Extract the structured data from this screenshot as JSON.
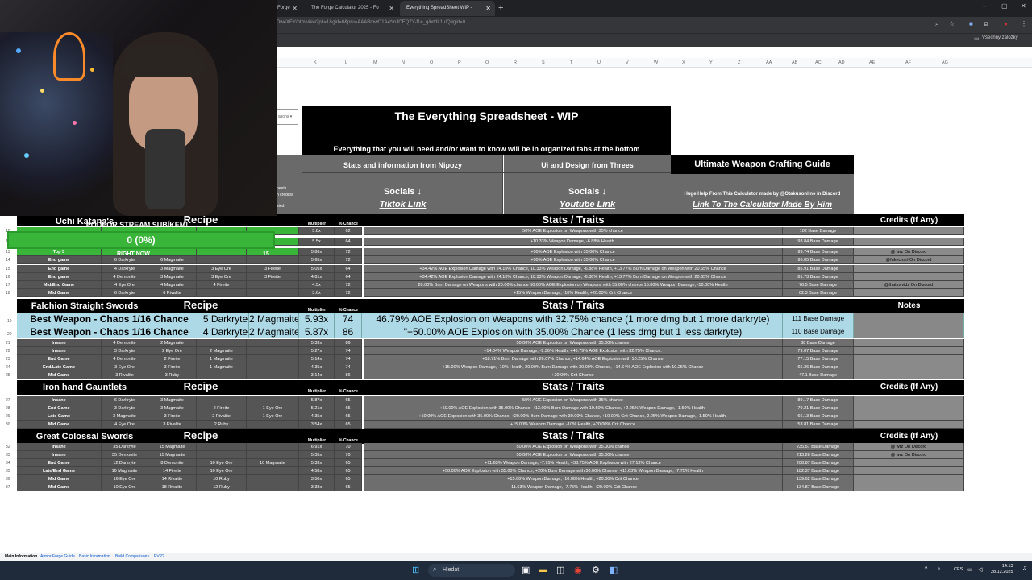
{
  "browser": {
    "tabs": [
      {
        "label": "Forge",
        "active": false
      },
      {
        "label": "The Forge Calculator 2025 - Fo",
        "active": false
      },
      {
        "label": "Everything SpreadSheet WIP -",
        "active": true
      }
    ],
    "new_tab": "+",
    "window_controls": [
      "–",
      "▢",
      "✕"
    ],
    "url": "Dw4XEY/htmlview?pli=1&gid=0&pru=AAABmwO1A4*mJCEQZY-f1e_q/ixtdL1uIQ#gid=0",
    "bookmarks_label": "Všechny záložky"
  },
  "sheet": {
    "columns": [
      "K",
      "L",
      "M",
      "N",
      "O",
      "P",
      "Q",
      "R",
      "S",
      "T",
      "U",
      "V",
      "W",
      "X",
      "Y",
      "Z",
      "AA",
      "AB",
      "AC",
      "AD",
      "AE",
      "AF",
      "AG"
    ],
    "dropdown_label": "asons",
    "side_text": [
      "heets",
      "h credits/",
      "sted"
    ],
    "title": "The Everything Spreadsheet - WIP",
    "subtitle": "Everything that you will need and/or want to know will be in organized tabs at the bottom",
    "credit_left": "Stats and information from Nipozy",
    "credit_right": "Ui and Design from Threes",
    "guide_title": "Ultimate Weapon Crafting Guide",
    "socials_label": "Socials ↓",
    "tiktok_link": "Tiktok Link",
    "youtube_link": "Youtube Link",
    "guide_help": "Huge Help From This Calculator made by @Otakusonline in Discord",
    "guide_link": "Link To The Calculator Made By Him"
  },
  "overlay": {
    "title": "PODPOR STREAM SUBÍKEM!",
    "value": "0 (0%)",
    "right_now": "RIGHT NOW",
    "right_now_count": "15"
  },
  "sections": [
    {
      "name": "Uchi Katana's",
      "recipe": "Recipe",
      "stats": "Stats / Traits",
      "credits": "Credits (If Any)",
      "multiplier_label": "Multiplier",
      "chance_label": "% Chance",
      "rows": [
        {
          "rn": "10",
          "tier": "",
          "r1": "",
          "r2": "",
          "r3": "",
          "r4": "",
          "mult": "5.8x",
          "chance": "62",
          "traits": "50% AOE Explosion on Weapons with 35% chance",
          "dmg": "102 Base Damage",
          "credit": ""
        },
        {
          "rn": "12",
          "tier": "",
          "r1": "",
          "r2": "",
          "r3": "",
          "r4": "",
          "mult": "5.5x",
          "chance": "64",
          "traits": "+10.33% Weapon Damage, -6.88% Health.",
          "dmg": "93.84 Base Damage",
          "credit": ""
        },
        {
          "rn": "13",
          "tier": "Top 5",
          "r1": "",
          "r2": "",
          "r3": "",
          "r4": "",
          "mult": "5.86x",
          "chance": "72",
          "traits": "+50% AOE Explosion with 35.00% Chance",
          "dmg": "99.74 Base Damage",
          "credit": "@ wrz On Discord"
        },
        {
          "rn": "14",
          "tier": "End game",
          "r1": "6 Darkryte",
          "r2": "6 Magmaite",
          "r3": "",
          "r4": "",
          "mult": "5.65x",
          "chance": "72",
          "traits": "+50% AOE Explosion with 35.00% Chance",
          "dmg": "96.05 Base Damage",
          "credit": "@fakecharl On Discord"
        },
        {
          "rn": "15",
          "tier": "End game",
          "r1": "4 Darkryte",
          "r2": "3 Magmaite",
          "r3": "3 Eye Ore",
          "r4": "3 Fireite",
          "mult": "5.05x",
          "chance": "64",
          "traits": "+34.42% AOE Explosion Damage with 24.10% Chance, 10.33% Weapon Damage, -6.88% Health, +13.77% Burn Damage on Weapon with 20.65% Chance",
          "dmg": "85.91 Base Damage",
          "credit": ""
        },
        {
          "rn": "16",
          "tier": "End game",
          "r1": "4 Demonite",
          "r2": "3 Magmaite",
          "r3": "3 Eye Ore",
          "r4": "3 Fireite",
          "mult": "4.81x",
          "chance": "64",
          "traits": "+34.42% AOE Explosion Damage with 24.10% Chance, 10.33% Weapon Damage, -6.88% Health, +13.77% Burn Damage on Weapon with 20.65% Chance",
          "dmg": "81.73 Base Damage",
          "credit": ""
        },
        {
          "rn": "17",
          "tier": "Mid/End Game",
          "r1": "4 Eye Ore",
          "r2": "4 Magmaite",
          "r3": "4 Fireite",
          "r4": "",
          "mult": "4.5x",
          "chance": "72",
          "traits": "20.00% Burn Damage on Weapons with 20.00% chance 50.00% AOE Explosion on Weapons with 35.00% chance 15.00% Weapon Damage, -10.00% Health",
          "dmg": "76.5 Base Damage",
          "credit": "@thatsvividz On Discord"
        },
        {
          "rn": "18",
          "tier": "Mid Game",
          "r1": "6 Darkryte",
          "r2": "6 Rivalite",
          "r3": "",
          "r4": "",
          "mult": "3.6x",
          "chance": "72",
          "traits": "+15% Weapon Damage, -10% Health, +20.00% Crit Chance",
          "dmg": "62.3 Base Damage",
          "credit": ""
        }
      ]
    },
    {
      "name": "Falchion Straight Swords",
      "recipe": "Recipe",
      "stats": "Stats / Traits",
      "credits": "Notes",
      "multiplier_label": "Multiplier",
      "chance_label": "% Chance",
      "big_rows": [
        {
          "rn": "19",
          "tier": "Best Weapon - Chaos 1/16 Chance",
          "r1": "5 Darkryte",
          "r2": "2 Magmaite",
          "mult": "5.93x",
          "chance": "74",
          "traits": "46.79% AOE Explosion on Weapons with 32.75% chance (1 more dmg but 1 more darkryte)",
          "dmg": "111 Base Damage"
        },
        {
          "rn": "20",
          "tier": "Best Weapon - Chaos 1/16 Chance",
          "r1": "4 Darkryte",
          "r2": "2 Magmaite",
          "mult": "5.87x",
          "chance": "86",
          "traits": "\"+50.00% AOE Explosion with 35.00% Chance (1 less dmg but 1 less darkryte)",
          "dmg": "110 Base Damage"
        }
      ],
      "rows": [
        {
          "rn": "21",
          "tier": "Insane",
          "r1": "4 Demonite",
          "r2": "2 Magmaite",
          "r3": "",
          "r4": "",
          "mult": "5.33x",
          "chance": "86",
          "traits": "50.00% AOE Explosion on Weapons with 35.00% chance",
          "dmg": "88 Base Damage",
          "credit": ""
        },
        {
          "rn": "22",
          "tier": "Insane",
          "r1": "3 Darkryte",
          "r2": "2 Eye Ore",
          "r3": "2 Magmaite",
          "r4": "",
          "mult": "5.27x",
          "chance": "74",
          "traits": "+14.04% Weapon Damage, -9.36% Health, +46.79% AOE Explosion with 32.75% Chance.",
          "dmg": "79.07 Base Damage",
          "credit": ""
        },
        {
          "rn": "23",
          "tier": "End Game",
          "r1": "4 Demonite",
          "r2": "2 Fireite",
          "r3": "1 Magmaite",
          "r4": "",
          "mult": "5.14x",
          "chance": "74",
          "traits": "+18.71% Burn Damage with 26.07% Chance, +14.64% AOE Explosion with 10.25% Chance",
          "dmg": "77.15 Base Damage",
          "credit": ""
        },
        {
          "rn": "24",
          "tier": "End/Late Game",
          "r1": "3 Eye Ore",
          "r2": "3 Fireite",
          "r3": "1 Magmaite",
          "r4": "",
          "mult": "4.35x",
          "chance": "74",
          "traits": "+15.00% Weapon Damage, -10% Health, 20.00% Burn Damage with 30.00% Chance, +14.64% AOE Explosion with 10.25% Chance",
          "dmg": "65.36 Base Damage",
          "credit": ""
        },
        {
          "rn": "25",
          "tier": "Mid Game",
          "r1": "3 Rivalite",
          "r2": "3 Ruby",
          "r3": "",
          "r4": "",
          "mult": "3.14x",
          "chance": "86",
          "traits": "+20.00% Crit Chance",
          "dmg": "47.1 Base Damage",
          "credit": ""
        }
      ]
    },
    {
      "name": "Iron hand Gauntlets",
      "recipe": "Recipe",
      "stats": "Stats / Traits",
      "credits": "Credits (If Any)",
      "multiplier_label": "Multiplier",
      "chance_label": "% Chance",
      "rows": [
        {
          "rn": "27",
          "tier": "Insane",
          "r1": "6 Darkryte",
          "r2": "3 Magmaite",
          "r3": "",
          "r4": "",
          "mult": "5.87x",
          "chance": "65",
          "traits": "50% AOE Explosion on Weapons with 35% chance",
          "dmg": "89.17 Base Damage",
          "credit": ""
        },
        {
          "rn": "28",
          "tier": "End Game",
          "r1": "3 Darkryte",
          "r2": "3 Magmaite",
          "r3": "2 Fireite",
          "r4": "1 Eye Ore",
          "mult": "5.21x",
          "chance": "65",
          "traits": "+50.00% AOE Explosion with 35.00% Chance, +13.00% Burn Damage with 19.50% Chance, +2.25% Weapon Damage, -1.50% Health.",
          "dmg": "79.21 Base Damage",
          "credit": ""
        },
        {
          "rn": "29",
          "tier": "Late Game",
          "r1": "3 Magmaite",
          "r2": "3 Fireite",
          "r3": "2 Rivalite",
          "r4": "1 Eye Ore",
          "mult": "4.35x",
          "chance": "65",
          "traits": "+50.00% AOE Explosion with 35.00% Chance, +20.00% Burn Damage with 30.00% Chance, +10.00% Crit Chance, 2.25% Weapon Damage, -1.50% Health.",
          "dmg": "66.13 Base Damage",
          "credit": ""
        },
        {
          "rn": "30",
          "tier": "Mid Game",
          "r1": "4 Eye Ore",
          "r2": "3 Rivalite",
          "r3": "2 Ruby",
          "r4": "",
          "mult": "3.54x",
          "chance": "65",
          "traits": "+15.00% Weapon Damage, -10% Health, +20.00% Crit Chance",
          "dmg": "53.81 Base Damage",
          "credit": ""
        }
      ]
    },
    {
      "name": "Great Colossal Swords",
      "recipe": "Recipe",
      "stats": "Stats / Traits",
      "credits": "Credits (If Any)",
      "multiplier_label": "Multiplier",
      "chance_label": "% Chance",
      "rows": [
        {
          "rn": "32",
          "tier": "Insane",
          "r1": "35 Darkryte",
          "r2": "15 Magmaite",
          "r3": "",
          "r4": "",
          "mult": "6.91x",
          "chance": "70",
          "traits": "50.00% AOE Explosion on Weapons with 35.00% chance",
          "dmg": "235.57 Base Damage",
          "credit": "@ wrz On Discord"
        },
        {
          "rn": "33",
          "tier": "Insane",
          "r1": "35 Demonite",
          "r2": "15 Magmaite",
          "r3": "",
          "r4": "",
          "mult": "5.35x",
          "chance": "70",
          "traits": "50.00% AOE Explosion on Weapons with 35.00% chance",
          "dmg": "213.28 Base Damage",
          "credit": "@ wrz On Discord"
        },
        {
          "rn": "34",
          "tier": "End Game",
          "r1": "12 Darkryte",
          "r2": "8 Demonite",
          "r3": "10 Eye Ore",
          "r4": "10 Magmaite",
          "mult": "5.33x",
          "chance": "65",
          "traits": "+11.63% Weapon Damage, -7.75% Health, +38.75% AOE Explosion with 27.13% Chance",
          "dmg": "208.87 Base Damage",
          "credit": ""
        },
        {
          "rn": "35",
          "tier": "Late/End Game",
          "r1": "16 Magmaite",
          "r2": "14 Fireite",
          "r3": "10 Eye Ore",
          "r4": "",
          "mult": "4.58x",
          "chance": "65",
          "traits": "+50.00% AOE Explosion with 35.00% Chance, +20% Burn Damage with 30.00% Chance, +11.63% Weapon Damage, -7.75% Health",
          "dmg": "182.37 Base Damage",
          "credit": ""
        },
        {
          "rn": "36",
          "tier": "Mid Game",
          "r1": "16 Eye Ore",
          "r2": "14 Rivalite",
          "r3": "10 Ruby",
          "r4": "",
          "mult": "3.50x",
          "chance": "65",
          "traits": "+15.00% Weapon Damage, -10.00% Health, +20.00% Crit Chance",
          "dmg": "139.62 Base Damage",
          "credit": ""
        },
        {
          "rn": "37",
          "tier": "Mid Game",
          "r1": "10 Eye Ore",
          "r2": "18 Rivalite",
          "r3": "12 Ruby",
          "r4": "",
          "mult": "3.38x",
          "chance": "65",
          "traits": "+11.63% Weapon Damage, -7.75% Health, +20.00% Crit Chance",
          "dmg": "134.87 Base Damage",
          "credit": ""
        }
      ]
    }
  ],
  "sheet_tabs": [
    "Main Information",
    "Armor Forge Guide",
    "Basic Information",
    "Build Comparisons",
    "PVP?"
  ],
  "taskbar": {
    "search_placeholder": "Hledat",
    "lang": "CES",
    "time": "14:13",
    "date": "28.12.2025"
  }
}
